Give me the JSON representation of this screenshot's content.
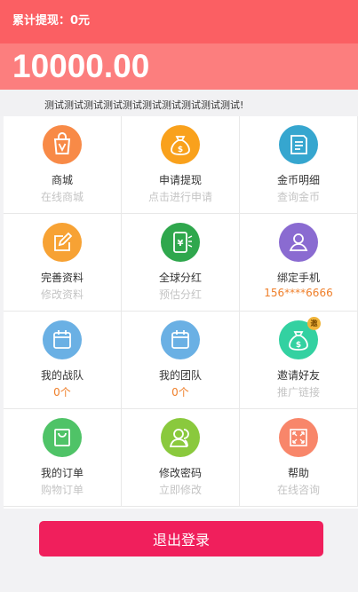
{
  "header": {
    "total_withdraw": "累计提现：0元",
    "balance": "10000.00"
  },
  "notice": "测试测试测试测试测试测试测试测试测试测试!",
  "colors": {
    "top_bar": "#fb5f63",
    "amount_bar": "#fc7e7e",
    "logout": "#f01f5c",
    "accent_orange": "#ef7f2a"
  },
  "menu": [
    {
      "label": "商城",
      "sub": "在线商城",
      "icon": "shopping-bag-icon",
      "color": "#f88a47"
    },
    {
      "label": "申请提现",
      "sub": "点击进行申请",
      "icon": "money-bag-icon",
      "color": "#f9a11c"
    },
    {
      "label": "金币明细",
      "sub": "查询金币",
      "icon": "document-icon",
      "color": "#36a6cf"
    },
    {
      "label": "完善资料",
      "sub": "修改资料",
      "icon": "edit-icon",
      "color": "#f7a234"
    },
    {
      "label": "全球分红",
      "sub": "预估分红",
      "icon": "phone-yuan-icon",
      "color": "#2fa74d"
    },
    {
      "label": "绑定手机",
      "sub": "156****6666",
      "icon": "user-phone-icon",
      "color": "#8a6bd1"
    },
    {
      "label": "我的战队",
      "sub": "0个",
      "icon": "calendar-icon",
      "color": "#6ab0e4"
    },
    {
      "label": "我的团队",
      "sub": "0个",
      "icon": "calendar-icon",
      "color": "#6ab0e4"
    },
    {
      "label": "邀请好友",
      "sub": "推广链接",
      "icon": "money-bag-icon",
      "color": "#33d1a1",
      "badge": "邀"
    },
    {
      "label": "我的订单",
      "sub": "购物订单",
      "icon": "shopping-bag-icon",
      "color": "#4fc367"
    },
    {
      "label": "修改密码",
      "sub": "立即修改",
      "icon": "users-icon",
      "color": "#8ac93d"
    },
    {
      "label": "帮助",
      "sub": "在线咨询",
      "icon": "expand-icon",
      "color": "#f8866a"
    }
  ],
  "logout_label": "退出登录"
}
